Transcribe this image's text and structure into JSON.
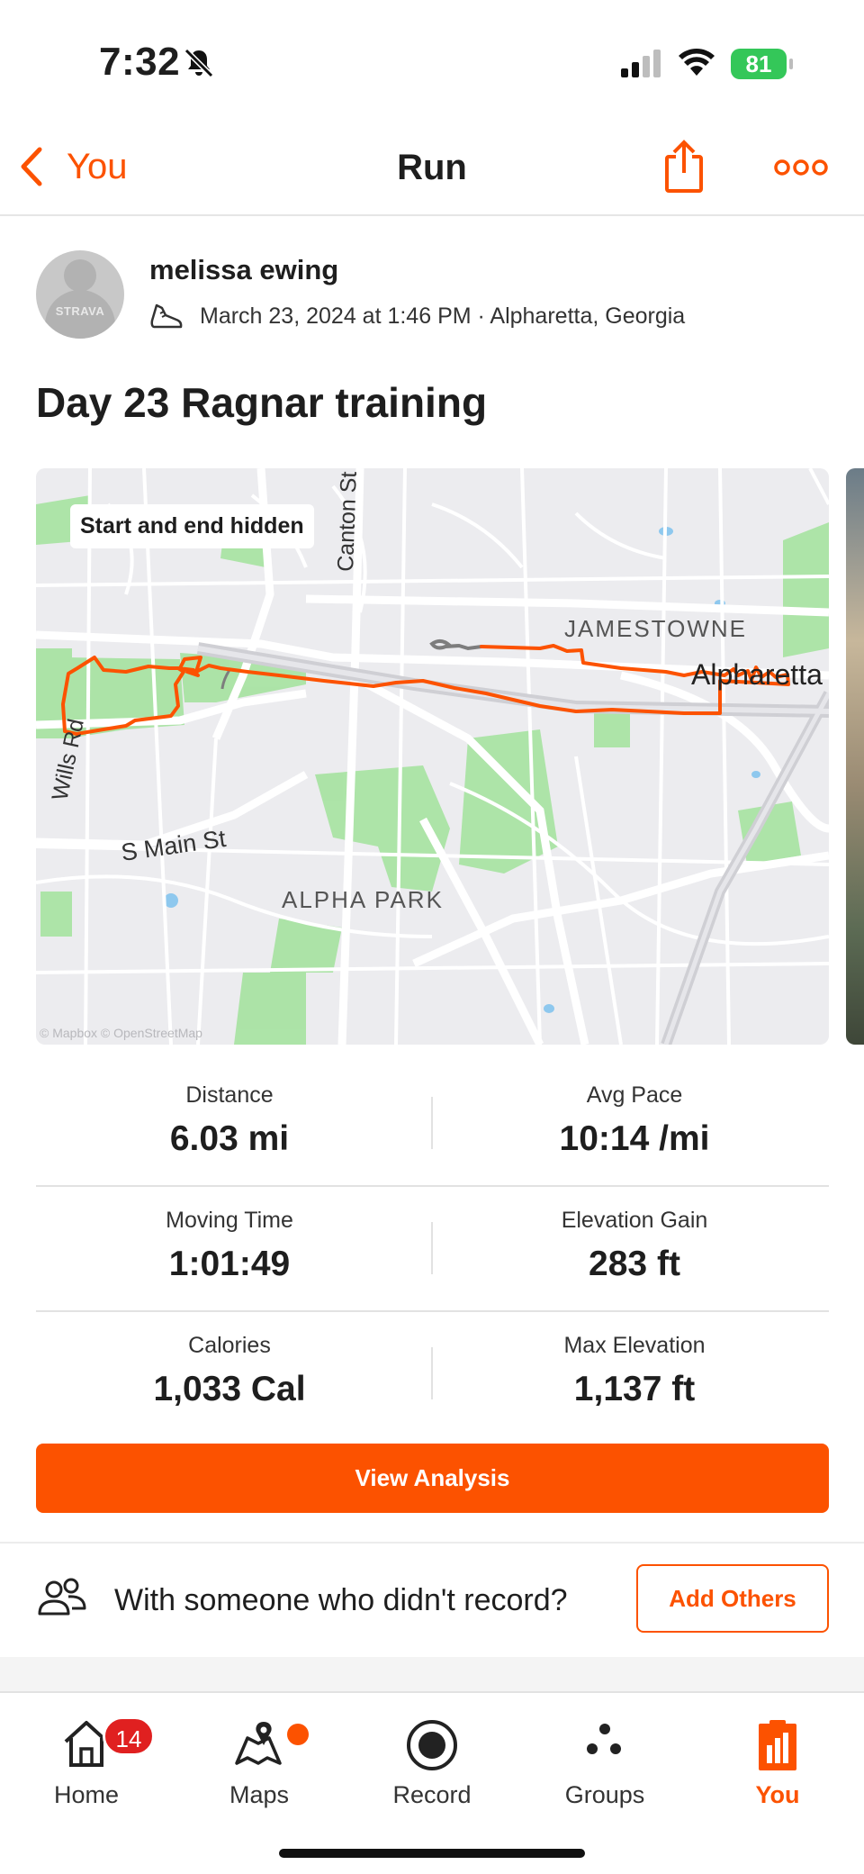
{
  "status_bar": {
    "time": "7:32",
    "battery": "81"
  },
  "nav": {
    "back_label": "You",
    "title": "Run"
  },
  "activity": {
    "athlete": "melissa ewing",
    "avatar_text": "STRAVA",
    "meta": "March 23, 2024 at 1:46 PM · Alpharetta, Georgia",
    "title": "Day 23 Ragnar training"
  },
  "map": {
    "badge": "Start and end hidden",
    "labels": {
      "jamestowne": "JAMESTOWNE",
      "alpharetta": "Alpharetta",
      "wills_rd": "Wills Rd",
      "s_main_st": "S Main St",
      "alpha_park": "ALPHA PARK",
      "canton_st": "Canton St"
    },
    "attribution": "© Mapbox © OpenStreetMap",
    "route_color": "#fc5200"
  },
  "stats": [
    {
      "label": "Distance",
      "value": "6.03 mi"
    },
    {
      "label": "Avg Pace",
      "value": "10:14 /mi"
    },
    {
      "label": "Moving Time",
      "value": "1:01:49"
    },
    {
      "label": "Elevation Gain",
      "value": "283 ft"
    },
    {
      "label": "Calories",
      "value": "1,033 Cal"
    },
    {
      "label": "Max Elevation",
      "value": "1,137 ft"
    }
  ],
  "actions": {
    "view_analysis": "View Analysis",
    "with_someone": "With someone who didn't record?",
    "add_others": "Add Others"
  },
  "tabbar": {
    "items": [
      {
        "label": "Home",
        "icon": "home-icon",
        "badge": "14"
      },
      {
        "label": "Maps",
        "icon": "maps-icon"
      },
      {
        "label": "Record",
        "icon": "record-icon"
      },
      {
        "label": "Groups",
        "icon": "groups-icon"
      },
      {
        "label": "You",
        "icon": "you-icon",
        "active": true
      }
    ]
  },
  "colors": {
    "accent": "#fc5200",
    "park": "#a6e3a0",
    "map_bg": "#ececef",
    "badge": "#e02020"
  }
}
